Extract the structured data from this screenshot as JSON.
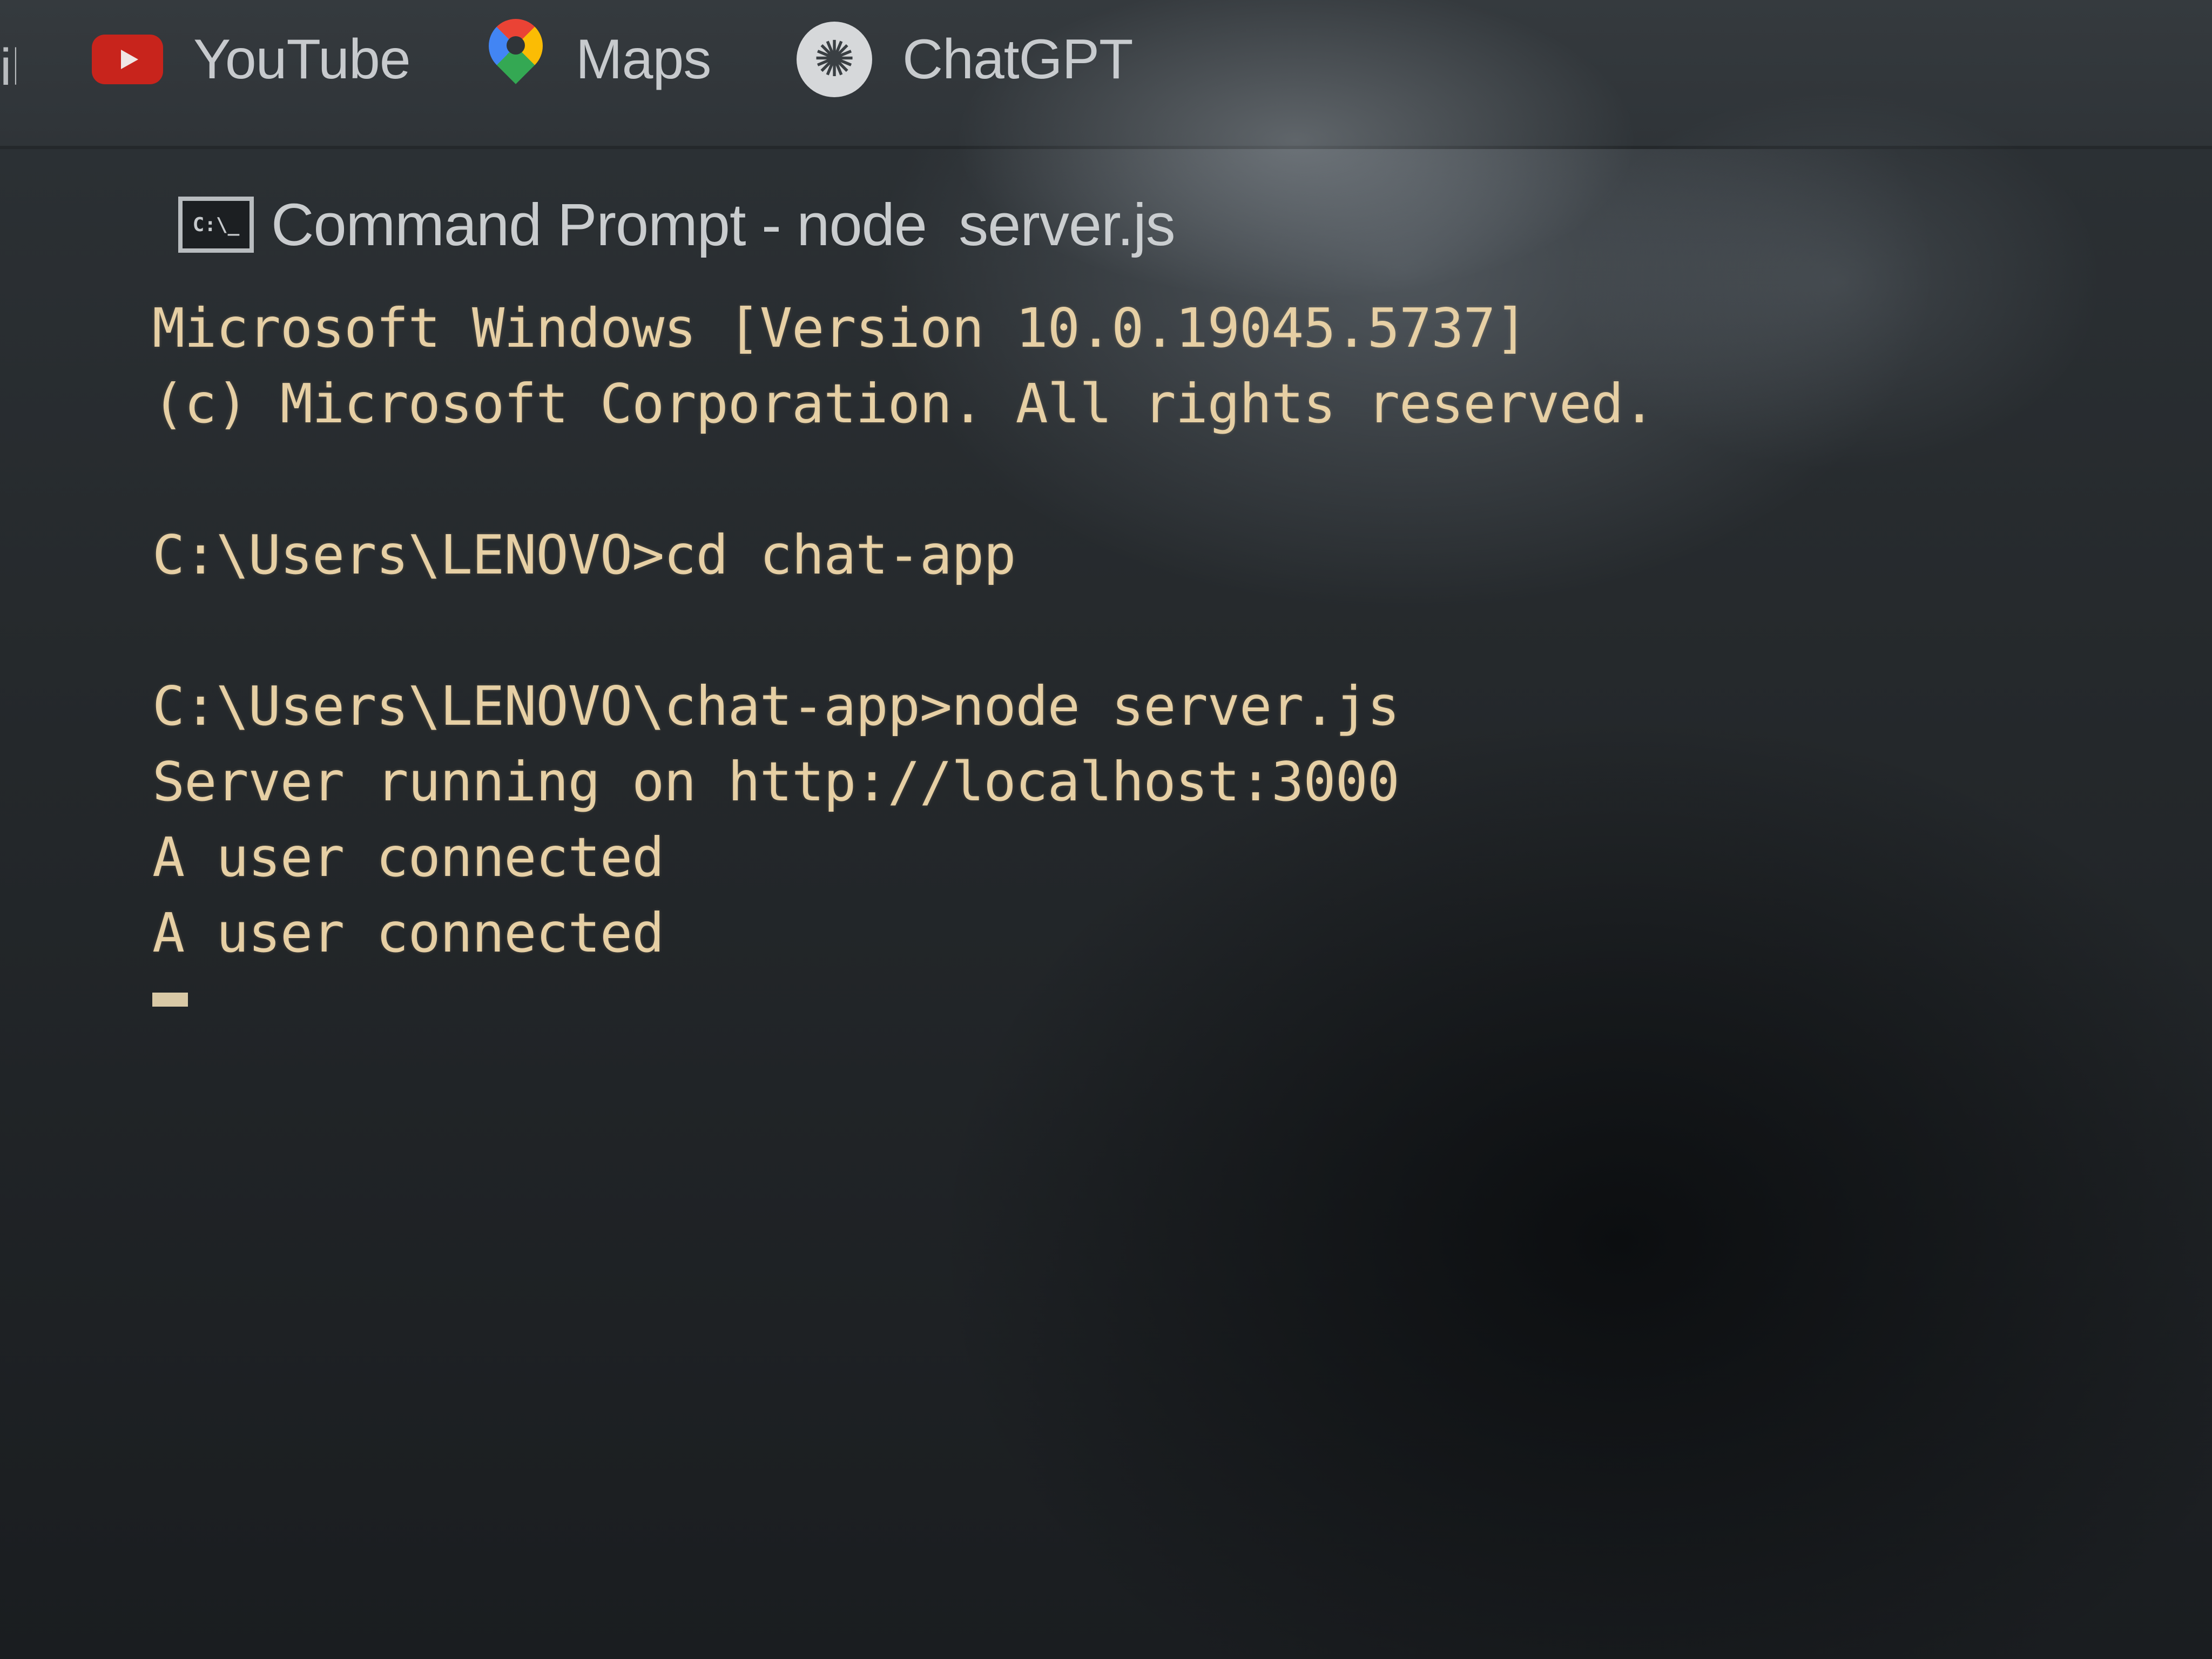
{
  "bookmarks_bar": {
    "partial_item_text": "il",
    "items": [
      {
        "label": "YouTube",
        "icon": "youtube-icon"
      },
      {
        "label": "Maps",
        "icon": "google-maps-icon"
      },
      {
        "label": "ChatGPT",
        "icon": "chatgpt-icon"
      }
    ]
  },
  "console": {
    "title": "Command Prompt - node  server.js",
    "icon_text": "C:\\_",
    "lines": [
      "Microsoft Windows [Version 10.0.19045.5737]",
      "(c) Microsoft Corporation. All rights reserved.",
      "",
      "C:\\Users\\LENOVO>cd chat-app",
      "",
      "C:\\Users\\LENOVO\\chat-app>node server.js",
      "Server running on http://localhost:3000",
      "A user connected",
      "A user connected"
    ]
  },
  "colors": {
    "console_text": "#e6cfa4",
    "console_background": "#25292c",
    "bookmark_text": "#c7cacd",
    "youtube_red": "#c8241c"
  }
}
